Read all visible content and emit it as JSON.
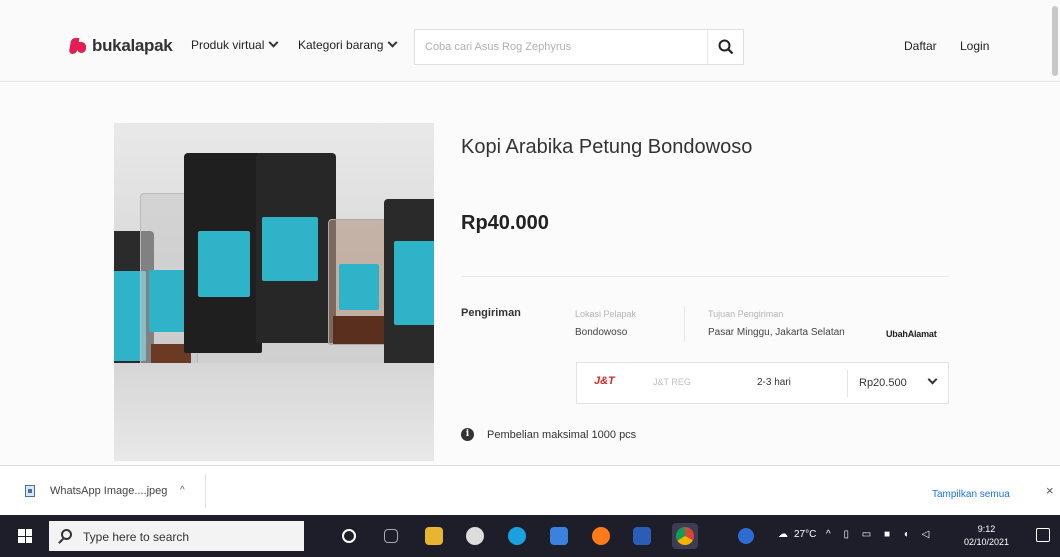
{
  "header": {
    "logo_text": "bukalapak",
    "nav": [
      {
        "label": "Produk virtual"
      },
      {
        "label": "Kategori barang"
      }
    ],
    "search_placeholder": "Coba cari Asus Rog Zephyrus",
    "daftar": "Daftar",
    "login": "Login"
  },
  "product": {
    "title": "Kopi Arabika Petung Bondowoso",
    "price": "Rp40.000",
    "shipping": {
      "label": "Pengiriman",
      "origin_caption": "Lokasi Pelapak",
      "origin": "Bondowoso",
      "dest_caption": "Tujuan Pengiriman",
      "destination": "Pasar Minggu, Jakarta Selatan",
      "change_address": "UbahAlamat",
      "courier_logo": "J&T",
      "courier_name": "J&T REG",
      "eta": "2-3 hari",
      "cost": "Rp20.500"
    },
    "info": "Pembelian maksimal 1000 pcs"
  },
  "download_bar": {
    "file_name": "WhatsApp Image....jpeg",
    "show_all": "Tampilkan semua",
    "close": "×"
  },
  "taskbar": {
    "search_text": "Type here to search",
    "weather": "27°C",
    "time": "9:12",
    "date": "02/10/2021"
  }
}
